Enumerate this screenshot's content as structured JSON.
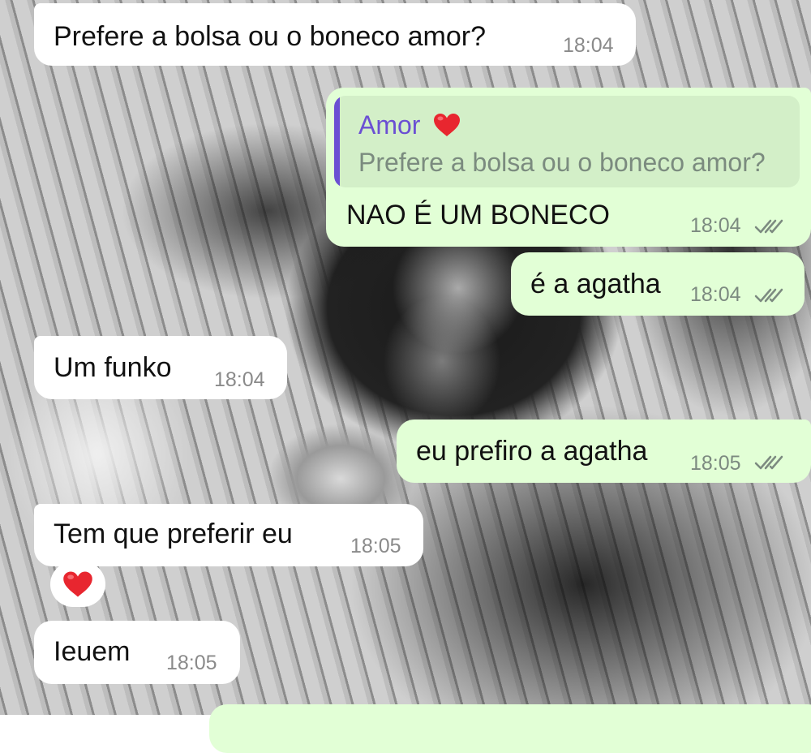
{
  "messages": [
    {
      "text": "Prefere a bolsa ou o boneco amor?",
      "time": "18:04"
    },
    {
      "text": "NAO É UM BONECO",
      "time": "18:04",
      "reply_author": "Amor",
      "reply_author_emoji": "red-heart",
      "reply_text": "Prefere a bolsa ou o boneco amor?"
    },
    {
      "text": "é a agatha",
      "time": "18:04"
    },
    {
      "text": "Um funko",
      "time": "18:04"
    },
    {
      "text": "eu prefiro a agatha",
      "time": "18:05"
    },
    {
      "text": "Tem que preferir eu",
      "time": "18:05"
    },
    {
      "reaction": "red-heart"
    },
    {
      "text": "Ieuem",
      "time": "18:05"
    }
  ],
  "colors": {
    "incoming_bubble": "#ffffff",
    "outgoing_bubble": "#e2ffd6",
    "quote_accent": "#6b4fd3",
    "heart": "#e8262f"
  }
}
